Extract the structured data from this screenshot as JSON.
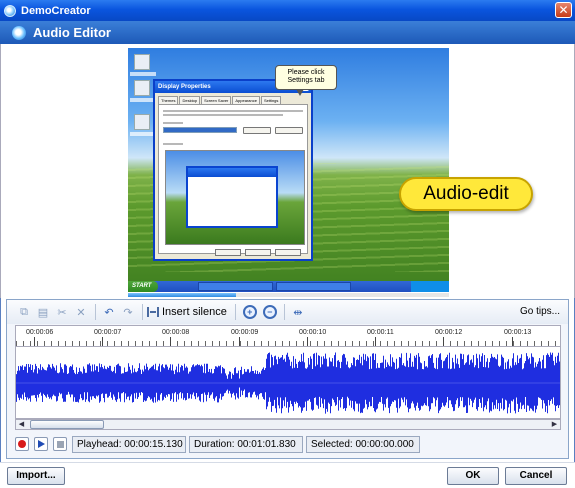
{
  "window": {
    "title": "DemoCreator"
  },
  "header": {
    "title": "Audio Editor"
  },
  "preview": {
    "callout_line1": "Please click",
    "callout_line2": "Settings  tab",
    "badge": "Audio-edit",
    "taskbar_start": "START",
    "dialog_title": "Display Properties",
    "dialog_tabs": [
      "Themes",
      "Desktop",
      "Screen Saver",
      "Appearance",
      "Settings"
    ]
  },
  "toolbar": {
    "insert_silence_label": "Insert silence",
    "go_tips_label": "Go tips..."
  },
  "timeline": {
    "labels": [
      "00:00:06",
      "00:00:07",
      "00:00:08",
      "00:00:09",
      "00:00:10",
      "00:00:11",
      "00:00:12",
      "00:00:13"
    ]
  },
  "status": {
    "playhead": "Playhead: 00:00:15.130",
    "duration": "Duration: 00:01:01.830",
    "selected": "Selected: 00:00:00.000"
  },
  "footer": {
    "import_label": "Import...",
    "ok_label": "OK",
    "cancel_label": "Cancel"
  },
  "colors": {
    "title_bar": "#0a55de",
    "waveform": "#1f2ee0",
    "badge": "#ffe83a"
  }
}
